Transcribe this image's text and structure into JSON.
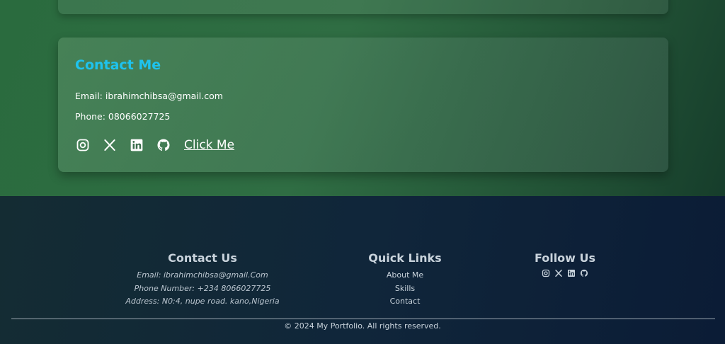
{
  "contact_card": {
    "title": "Contact Me",
    "email": "Email: ibrahimchibsa@gmail.com",
    "phone": "Phone: 08066027725",
    "social_icons": [
      "instagram-icon",
      "x-icon",
      "linkedin-icon",
      "github-icon"
    ],
    "cta_label": "Click Me",
    "title_color": "#1ec3ee"
  },
  "footer": {
    "contact": {
      "title": "Contact Us",
      "email": "Email: ibrahimchibsa@gmail.Com",
      "phone": "Phone Number: +234 8066027725",
      "address": "Address: N0:4, nupe road. kano,Nigeria"
    },
    "quick_links": {
      "title": "Quick Links",
      "items": [
        "About Me",
        "Skills",
        "Contact"
      ]
    },
    "follow": {
      "title": "Follow Us",
      "icons": [
        "instagram-icon",
        "x-icon",
        "linkedin-icon",
        "github-icon"
      ]
    },
    "copyright": "© 2024 My Portfolio. All rights reserved."
  }
}
